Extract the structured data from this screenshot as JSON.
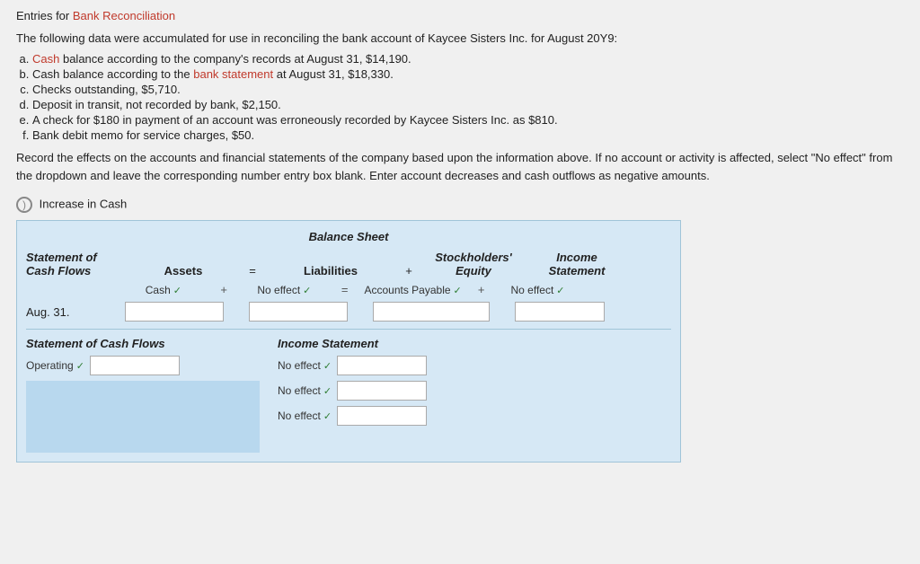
{
  "page": {
    "entries_label": "Entries for",
    "entries_link": "Bank Reconciliation",
    "intro": "The following data were accumulated for use in reconciling the bank account of Kaycee Sisters Inc. for August 20Y9:",
    "list_items": [
      {
        "label": "a.",
        "text": "Cash",
        "text_link": true,
        "rest": " balance according to the company's records at August 31, $14,190."
      },
      {
        "label": "b.",
        "text": "Cash balance according to the ",
        "link_text": "bank statement",
        "rest": " at August 31, $18,330."
      },
      {
        "label": "c.",
        "text": "Checks outstanding, $5,710."
      },
      {
        "label": "d.",
        "text": "Deposit in transit, not recorded by bank, $2,150."
      },
      {
        "label": "e.",
        "text": "A check for $180 in payment of an account was erroneously recorded by Kaycee Sisters Inc. as $810."
      },
      {
        "label": "f.",
        "text": "Bank debit memo for service charges, $50."
      }
    ],
    "instructions": "Record the effects on the accounts and financial statements of the company based upon the information above. If no account or activity is affected, select \"No effect\" from the dropdown and leave the corresponding number entry box blank. Enter account decreases and cash outflows as negative amounts.",
    "section_label": "Increase in Cash",
    "balance_sheet_title": "Balance Sheet",
    "headers": {
      "statement_of_cash_flows": "Statement of\nCash Flows",
      "assets": "Assets",
      "equals": "=",
      "liabilities": "Liabilities",
      "plus": "+",
      "stockholders_equity": "Stockholders'\nEquity",
      "income_statement": "Income\nStatement"
    },
    "sub_headers": {
      "cash": "Cash",
      "plus": "+",
      "no_effect_1": "No effect",
      "equals": "=",
      "accounts_payable": "Accounts Payable",
      "plus2": "+",
      "no_effect_2": "No effect"
    },
    "data_row": {
      "label": "Aug. 31."
    },
    "bottom": {
      "left_header": "Statement of Cash Flows",
      "right_header": "Income Statement",
      "operating": "Operating",
      "no_effect_rows": [
        "No effect",
        "No effect",
        "No effect"
      ]
    }
  }
}
